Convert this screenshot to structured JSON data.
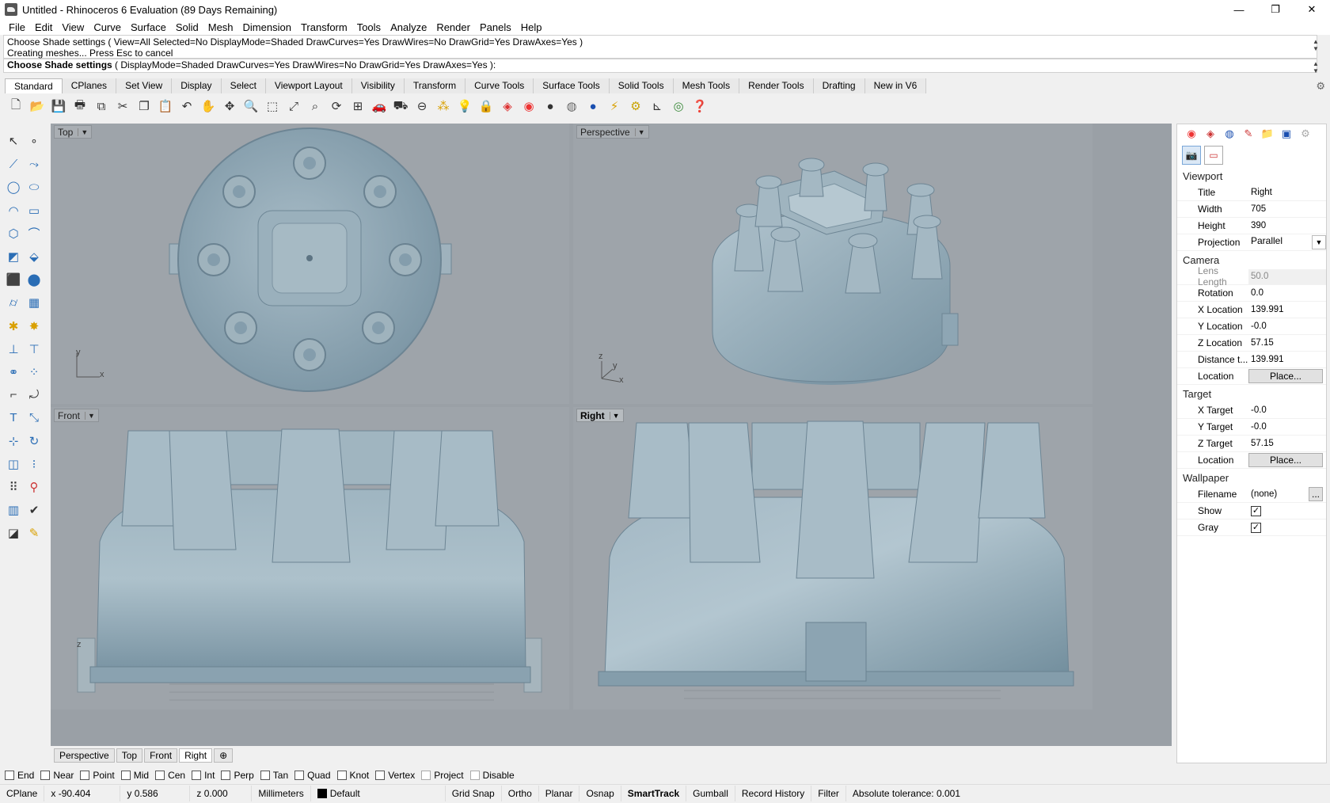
{
  "window": {
    "title": "Untitled - Rhinoceros 6 Evaluation (89 Days Remaining)",
    "min": "—",
    "max": "❐",
    "close": "✕"
  },
  "menu": [
    "File",
    "Edit",
    "View",
    "Curve",
    "Surface",
    "Solid",
    "Mesh",
    "Dimension",
    "Transform",
    "Tools",
    "Analyze",
    "Render",
    "Panels",
    "Help"
  ],
  "command": {
    "history_line1": "Choose Shade settings ( View=All  Selected=No  DisplayMode=Shaded  DrawCurves=Yes  DrawWires=No  DrawGrid=Yes  DrawAxes=Yes )",
    "history_line2": "Creating meshes... Press Esc to cancel",
    "prompt_bold": "Choose Shade settings",
    "prompt_rest": " ( DisplayMode=Shaded  DrawCurves=Yes  DrawWires=No  DrawGrid=Yes  DrawAxes=Yes ):"
  },
  "tabs": [
    "Standard",
    "CPlanes",
    "Set View",
    "Display",
    "Select",
    "Viewport Layout",
    "Visibility",
    "Transform",
    "Curve Tools",
    "Surface Tools",
    "Solid Tools",
    "Mesh Tools",
    "Render Tools",
    "Drafting",
    "New in V6"
  ],
  "viewports": {
    "top": "Top",
    "perspective": "Perspective",
    "front": "Front",
    "right": "Right",
    "axis_x": "x",
    "axis_y": "y",
    "axis_z": "z"
  },
  "viewport_tabs": [
    "Perspective",
    "Top",
    "Front",
    "Right",
    "⊕"
  ],
  "panel": {
    "viewport_title": "Viewport",
    "title_label": "Title",
    "title_value": "Right",
    "width_label": "Width",
    "width_value": "705",
    "height_label": "Height",
    "height_value": "390",
    "projection_label": "Projection",
    "projection_value": "Parallel",
    "camera_title": "Camera",
    "lens_label": "Lens Length",
    "lens_value": "50.0",
    "rotation_label": "Rotation",
    "rotation_value": "0.0",
    "xloc_label": "X Location",
    "xloc_value": "139.991",
    "yloc_label": "Y Location",
    "yloc_value": "-0.0",
    "zloc_label": "Z Location",
    "zloc_value": "57.15",
    "dist_label": "Distance t...",
    "dist_value": "139.991",
    "location_label": "Location",
    "place_label": "Place...",
    "target_title": "Target",
    "xtarget_label": "X Target",
    "xtarget_value": "-0.0",
    "ytarget_label": "Y Target",
    "ytarget_value": "-0.0",
    "ztarget_label": "Z Target",
    "ztarget_value": "57.15",
    "wallpaper_title": "Wallpaper",
    "filename_label": "Filename",
    "filename_value": "(none)",
    "browse": "...",
    "show_label": "Show",
    "gray_label": "Gray",
    "check": "✓"
  },
  "osnaps": [
    "End",
    "Near",
    "Point",
    "Mid",
    "Cen",
    "Int",
    "Perp",
    "Tan",
    "Quad",
    "Knot",
    "Vertex",
    "Project",
    "Disable"
  ],
  "status": {
    "cplane": "CPlane",
    "x": "x -90.404",
    "y": "y 0.586",
    "z": "z 0.000",
    "units": "Millimeters",
    "layer": "Default",
    "grid_snap": "Grid Snap",
    "ortho": "Ortho",
    "planar": "Planar",
    "osnap": "Osnap",
    "smarttrack": "SmartTrack",
    "gumball": "Gumball",
    "record_history": "Record History",
    "filter": "Filter",
    "tolerance": "Absolute tolerance: 0.001"
  },
  "colors": {
    "viewport_bg": "#9ea4aa",
    "model": "#8fa8b6",
    "accent": "#2a6db5"
  }
}
